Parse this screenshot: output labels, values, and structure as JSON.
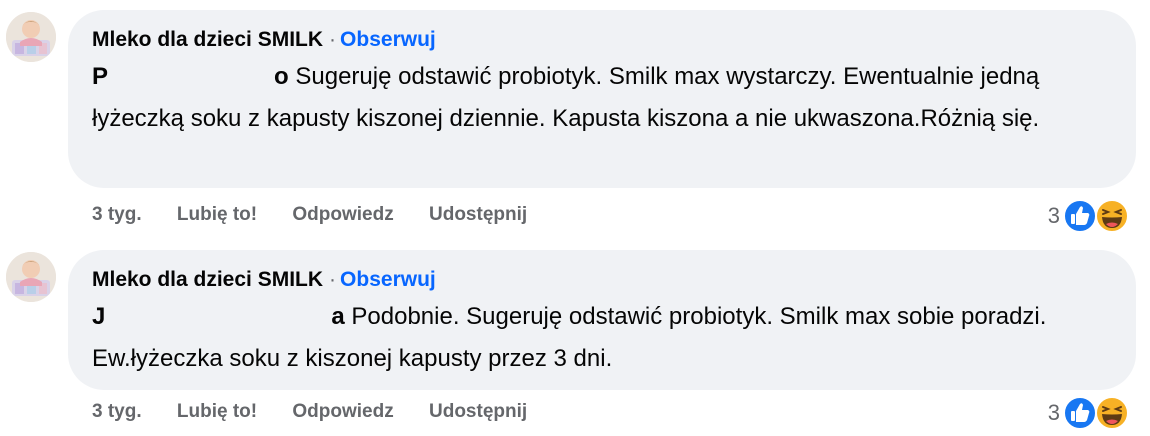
{
  "comments": [
    {
      "author": "Mleko dla dzieci SMILK",
      "separator": "·",
      "follow_label": "Obserwuj",
      "mention_first": "P",
      "mention_last": "o",
      "text": "Sugeruję odstawić probiotyk. Smilk max wystarczy. Ewentualnie jedną łyżeczką soku z kapusty kiszonej dziennie. Kapusta kiszona a nie ukwaszona.Różnią się.",
      "time": "3 tyg.",
      "like_label": "Lubię to!",
      "reply_label": "Odpowiedz",
      "share_label": "Udostępnij",
      "reaction_count": "3",
      "reaction_icons": [
        "like-icon",
        "haha-icon"
      ]
    },
    {
      "author": "Mleko dla dzieci SMILK",
      "separator": "·",
      "follow_label": "Obserwuj",
      "mention_first": "J",
      "mention_last": "a",
      "text": "Podobnie. Sugeruję odstawić probiotyk. Smilk max sobie poradzi. Ew.łyżeczka soku z kiszonej kapusty przez 3 dni.",
      "time": "3 tyg.",
      "like_label": "Lubię to!",
      "reply_label": "Odpowiedz",
      "share_label": "Udostępnij",
      "reaction_count": "3",
      "reaction_icons": [
        "like-icon",
        "haha-icon"
      ]
    }
  ],
  "colors": {
    "bubble": "#f0f2f5",
    "follow": "#0866ff",
    "meta": "#65676b",
    "like_icon": "#1877f2",
    "haha_icon": "#f7b125"
  }
}
